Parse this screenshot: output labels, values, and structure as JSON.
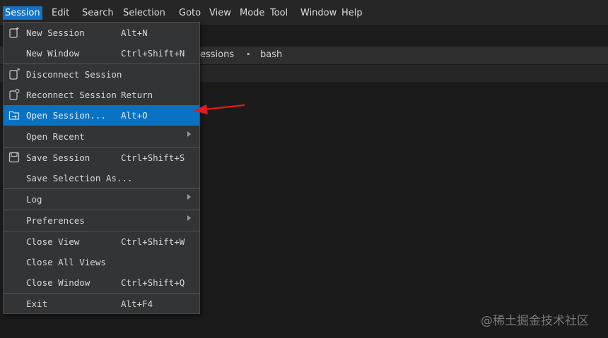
{
  "menubar": {
    "items": [
      "Session",
      "Edit",
      "Search",
      "Selection",
      "Goto",
      "View",
      "Mode",
      "Tool",
      "Window",
      "Help"
    ],
    "active": "Session"
  },
  "breadcrumb": {
    "items": [
      "essions",
      "bash"
    ],
    "separator": "▸"
  },
  "session_menu": {
    "items": [
      {
        "label": "New Session",
        "shortcut": "Alt+N",
        "icon": "new-session-icon"
      },
      {
        "label": "New Window",
        "shortcut": "Ctrl+Shift+N"
      },
      {
        "label": "Disconnect Session",
        "shortcut": "",
        "icon": "disconnect-icon"
      },
      {
        "label": "Reconnect Session",
        "shortcut": "Return",
        "icon": "reconnect-icon"
      },
      {
        "label": "Open Session...",
        "shortcut": "Alt+O",
        "icon": "open-folder-icon",
        "highlighted": true
      },
      {
        "label": "Open Recent",
        "shortcut": "",
        "submenu": true
      },
      {
        "label": "Save Session",
        "shortcut": "Ctrl+Shift+S",
        "icon": "save-icon"
      },
      {
        "label": "Save Selection As...",
        "shortcut": ""
      },
      {
        "label": "Log",
        "shortcut": "",
        "submenu": true
      },
      {
        "label": "Preferences",
        "shortcut": "",
        "submenu": true
      },
      {
        "label": "Close View",
        "shortcut": "Ctrl+Shift+W"
      },
      {
        "label": "Close All Views",
        "shortcut": ""
      },
      {
        "label": "Close Window",
        "shortcut": "Ctrl+Shift+Q"
      },
      {
        "label": "Exit",
        "shortcut": "Alt+F4"
      }
    ]
  },
  "watermark": "@稀土掘金技术社区",
  "colors": {
    "accent": "#1473c7",
    "highlight": "#0a72c2",
    "annotation_arrow": "#e01c1c"
  }
}
